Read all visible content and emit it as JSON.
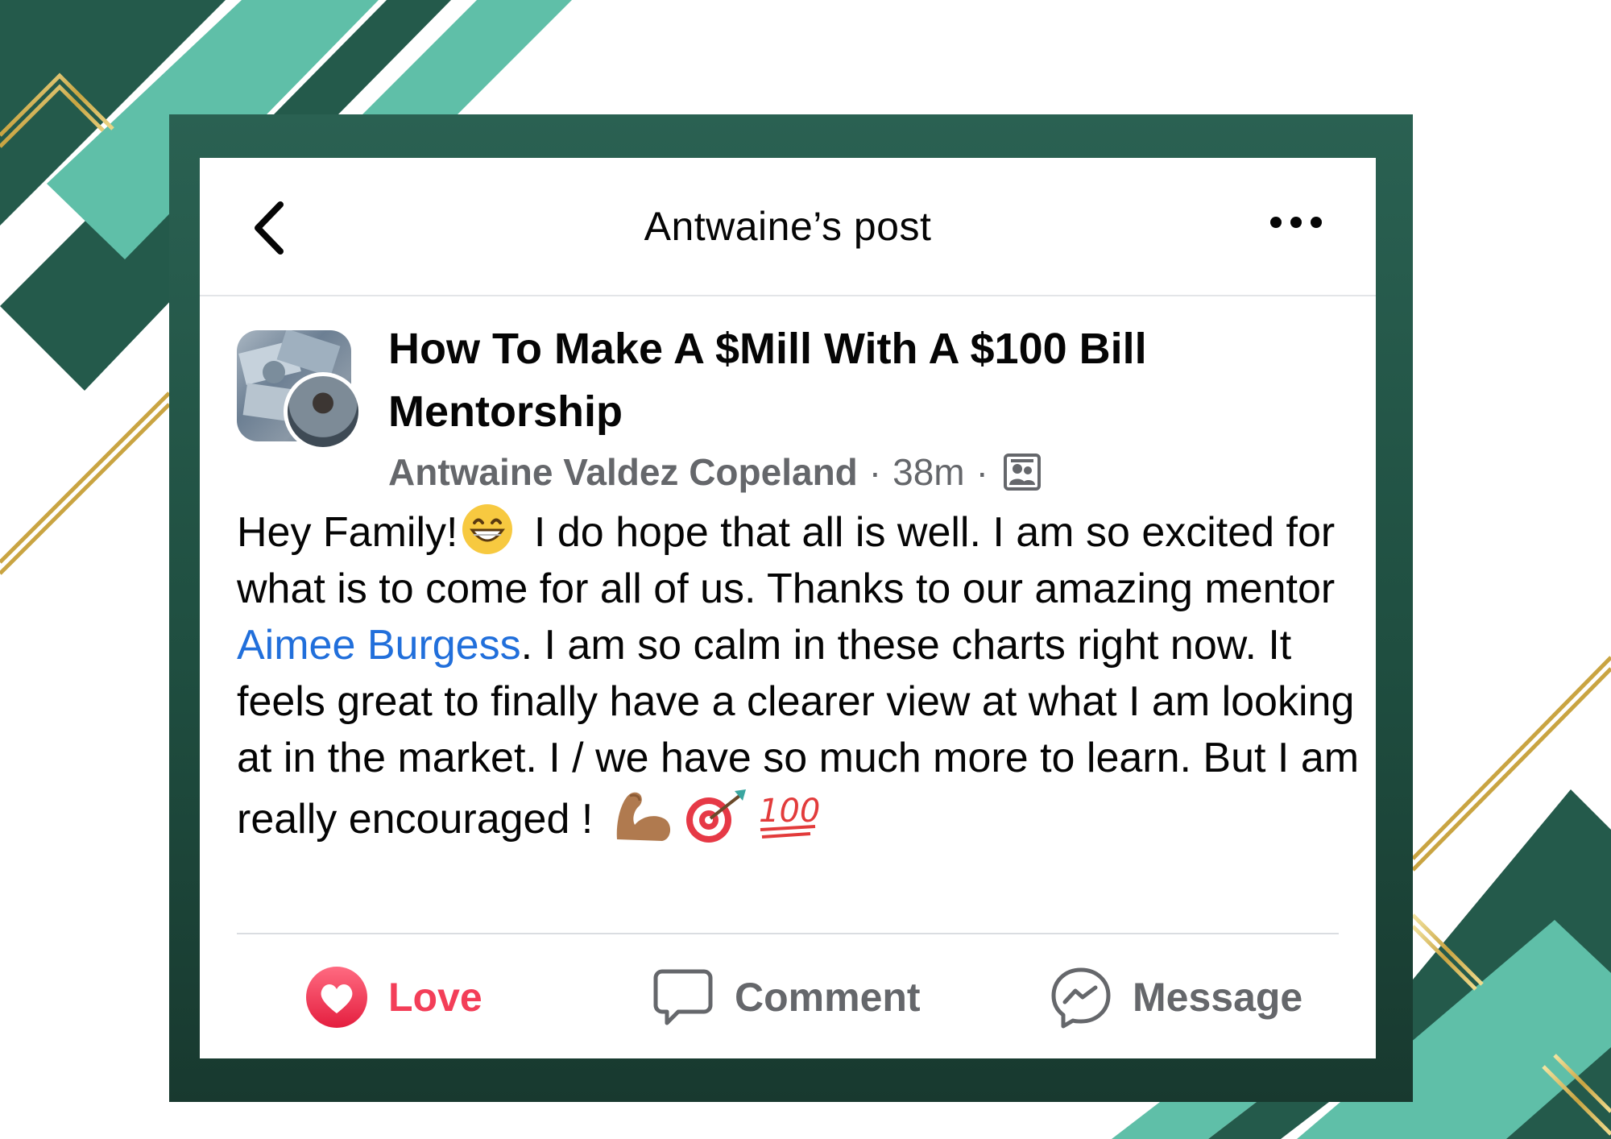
{
  "header": {
    "title": "Antwaine’s post"
  },
  "post": {
    "group_title": "How To Make A $Mill With A $100 Bill Mentorship",
    "author": "Antwaine Valdez Copeland",
    "time": "38m",
    "separator": "·",
    "body_part1": "Hey Family!",
    "body_part2": " I do hope that all is well. I am so excited for what is to come for all of us. Thanks to our amazing mentor ",
    "mention": "Aimee Burgess",
    "body_part3": ". I am so calm in these charts right now. It feels great to finally have a clearer view at what I am looking at in the market. I / we have so much more to learn. But I am really encouraged !",
    "emojis": [
      "grinning-face",
      "flexed-biceps",
      "direct-hit",
      "hundred-points"
    ]
  },
  "actions": {
    "love": "Love",
    "comment": "Comment",
    "message": "Message"
  },
  "colors": {
    "frame": "#245a4b",
    "accent_teal": "#5fbfa8",
    "gold": "#d7b54f",
    "love_red": "#f33e58",
    "mention_blue": "#216fdb"
  }
}
